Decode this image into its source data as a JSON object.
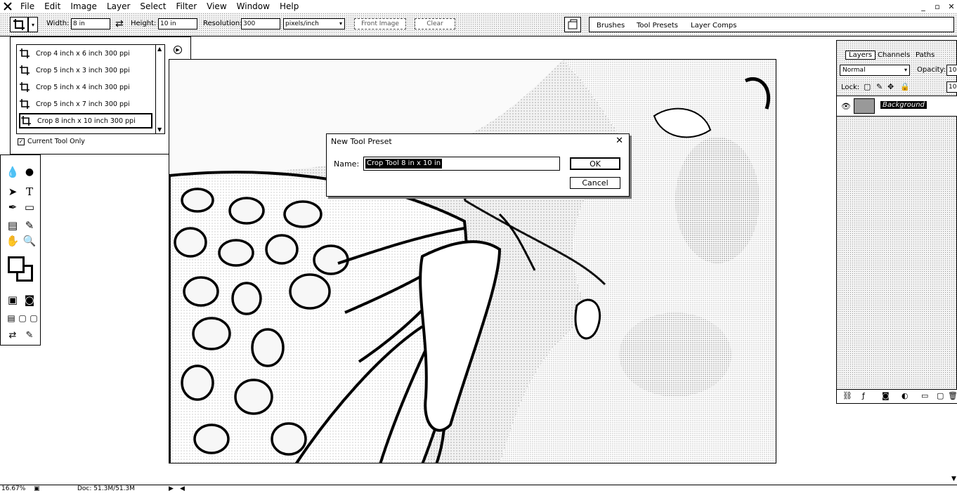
{
  "menubar": {
    "items": [
      "File",
      "Edit",
      "Image",
      "Layer",
      "Select",
      "Filter",
      "View",
      "Window",
      "Help"
    ],
    "window_controls": [
      "_",
      "▫",
      "✕"
    ]
  },
  "options": {
    "width_label": "Width:",
    "width_value": "8 in",
    "swap_icon": "⇄",
    "height_label": "Height:",
    "height_value": "10 in",
    "resolution_label": "Resolution:",
    "resolution_value": "300",
    "resolution_unit": "pixels/inch",
    "front_image": "Front Image",
    "clear": "Clear"
  },
  "palette_well": {
    "tabs": [
      "Brushes",
      "Tool Presets",
      "Layer Comps"
    ]
  },
  "tool_presets": {
    "items": [
      "Crop 4 inch x 6 inch 300 ppi",
      "Crop 5 inch x 3 inch 300 ppi",
      "Crop 5 inch x 4 inch 300 ppi",
      "Crop 5 inch x 7 inch 300 ppi",
      "Crop 8 inch x 10 inch 300 ppi"
    ],
    "selected_index": 4,
    "current_tool_only": "Current Tool Only"
  },
  "dialog": {
    "title": "New Tool Preset",
    "name_label": "Name:",
    "name_value": "Crop Tool 8 in x 10 in",
    "ok": "OK",
    "cancel": "Cancel"
  },
  "layers": {
    "tabs": [
      "Layers",
      "Channels",
      "Paths"
    ],
    "blend_mode": "Normal",
    "opacity_label": "Opacity:",
    "opacity_value": "10",
    "lock_label": "Lock:",
    "fill_value": "10",
    "layer_name": "Background"
  },
  "status": {
    "zoom": "16.67%",
    "doc": "Doc: 51.3M/51.3M"
  }
}
